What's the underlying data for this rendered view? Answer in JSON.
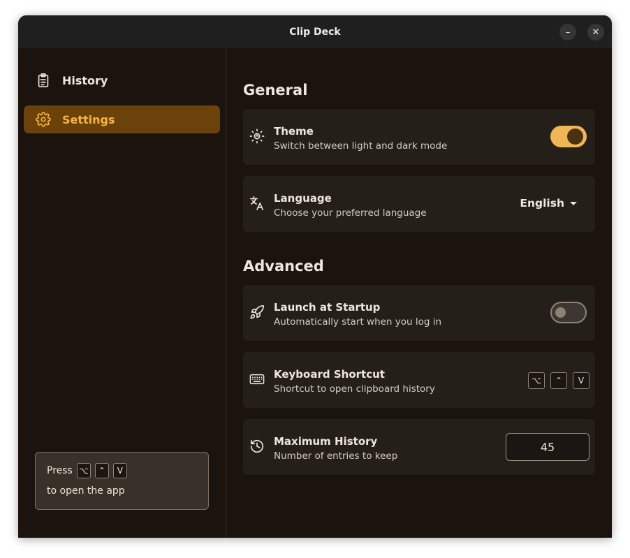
{
  "window": {
    "title": "Clip Deck",
    "minimize_glyph": "–",
    "close_glyph": "✕"
  },
  "sidebar": {
    "items": [
      {
        "label": "History",
        "icon": "clipboard-list-icon",
        "active": false
      },
      {
        "label": "Settings",
        "icon": "gear-icon",
        "active": true
      }
    ],
    "hint": {
      "prefix": "Press",
      "keys": [
        "⌥",
        "⌃",
        "V"
      ],
      "suffix": "to open the app"
    }
  },
  "colors": {
    "accent": "#efb556",
    "active_bg": "#6a420a",
    "active_text": "#f4b445",
    "background": "#1b140e",
    "card": "#251f19"
  },
  "main": {
    "general": {
      "title": "General",
      "theme": {
        "label": "Theme",
        "description": "Switch between light and dark mode",
        "enabled": true,
        "icon": "sun-icon"
      },
      "language": {
        "label": "Language",
        "description": "Choose your preferred language",
        "value": "English",
        "icon": "translate-icon"
      }
    },
    "advanced": {
      "title": "Advanced",
      "startup": {
        "label": "Launch at Startup",
        "description": "Automatically start when you log in",
        "enabled": false,
        "icon": "rocket-icon"
      },
      "shortcut": {
        "label": "Keyboard Shortcut",
        "description": "Shortcut to open clipboard history",
        "keys": [
          "⌥",
          "⌃",
          "V"
        ],
        "icon": "keyboard-icon"
      },
      "max_history": {
        "label": "Maximum History",
        "description": "Number of entries to keep",
        "value": "45",
        "icon": "history-icon"
      }
    }
  }
}
